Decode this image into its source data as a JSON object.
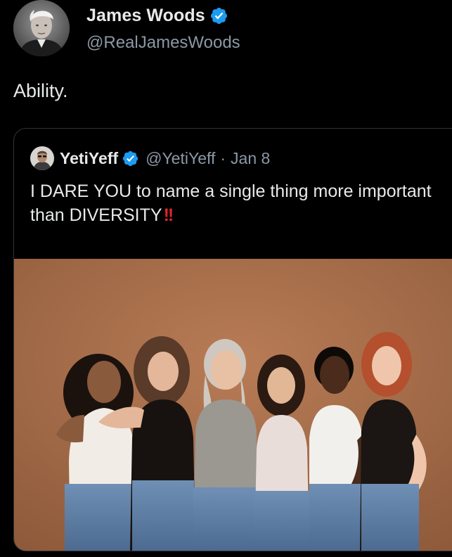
{
  "post": {
    "author": {
      "display_name": "James Woods",
      "handle": "@RealJamesWoods",
      "avatar_icon": "profile-photo",
      "verified_icon": "verified-badge-icon"
    },
    "text": "Ability."
  },
  "quote": {
    "author": {
      "display_name": "YetiYeff",
      "handle": "@YetiYeff",
      "separator": "·",
      "date": "Jan 8",
      "avatar_icon": "profile-photo",
      "verified_icon": "verified-badge-icon"
    },
    "text": "I DARE YOU to name a single thing more important than DIVERSITY",
    "emphasis": "!!",
    "media": {
      "type": "photo",
      "subject_count": 6
    }
  },
  "colors": {
    "background": "#000000",
    "text": "#e7e9ea",
    "secondary_text": "#8b98a5",
    "verified": "#1d9bf0",
    "border": "#2f3336",
    "exclamation": "#e0242c",
    "photo_backdrop": "#a86f4c"
  }
}
